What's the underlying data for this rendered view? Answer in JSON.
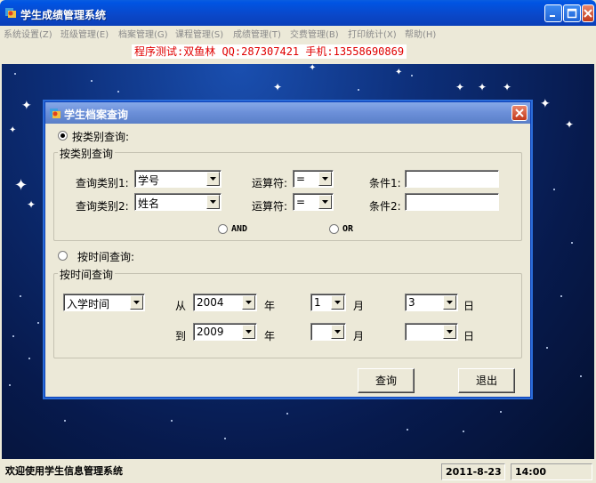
{
  "window": {
    "title": "学生成绩管理系统",
    "buttons": {
      "minimize_icon": "minimize-icon",
      "maximize_icon": "maximize-icon",
      "close_icon": "close-icon"
    }
  },
  "menu": {
    "items": [
      {
        "label": "系统设置(Z)"
      },
      {
        "label": "班级管理(E)"
      },
      {
        "label": "档案管理(G)"
      },
      {
        "label": "课程管理(S)"
      },
      {
        "label": "成绩管理(T)"
      },
      {
        "label": "交费管理(B)"
      },
      {
        "label": "打印统计(X)"
      },
      {
        "label": "帮助(H)"
      }
    ]
  },
  "banner": {
    "text": "程序测试:双鱼林 QQ:287307421 手机:13558690869",
    "color": "#e00000"
  },
  "dialog": {
    "title": "学生档案查询",
    "category_query": {
      "radio_label": "按类别查询:",
      "selected": true,
      "group_title": "按类别查询",
      "row1": {
        "field_label": "查询类别1:",
        "field_value": "学号",
        "op_label": "运算符:",
        "op_value": "=",
        "cond_label": "条件1:",
        "cond_value": ""
      },
      "row2": {
        "field_label": "查询类别2:",
        "field_value": "姓名",
        "op_label": "运算符:",
        "op_value": "=",
        "cond_label": "条件2:",
        "cond_value": ""
      },
      "and_label": "AND",
      "or_label": "OR"
    },
    "time_query": {
      "radio_label": "按时间查询:",
      "selected": false,
      "group_title": "按时间查询",
      "field_value": "入学时间",
      "from_label": "从",
      "to_label": "到",
      "from_year": "2004",
      "from_month": "1",
      "from_day": "3",
      "to_year": "2009",
      "to_month": "",
      "to_day": "",
      "year_label": "年",
      "month_label": "月",
      "day_label": "日"
    },
    "buttons": {
      "query": "查询",
      "exit": "退出"
    }
  },
  "status_bar": {
    "welcome": "欢迎使用学生信息管理系统",
    "date": "2011-8-23",
    "time": "14:00"
  }
}
